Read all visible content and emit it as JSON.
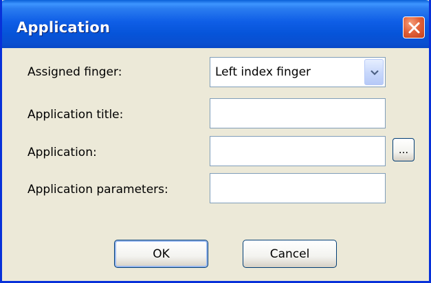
{
  "window": {
    "title": "Application",
    "close_label": "×"
  },
  "form": {
    "assigned_finger_label": "Assigned finger:",
    "assigned_finger_value": "Left index finger",
    "application_title_label": "Application title:",
    "application_title_value": "",
    "application_label": "Application:",
    "application_value": "",
    "browse_label": "...",
    "application_parameters_label": "Application parameters:",
    "application_parameters_value": ""
  },
  "buttons": {
    "ok_label": "OK",
    "cancel_label": "Cancel"
  },
  "colors": {
    "titlebar": "#0a5fd8",
    "window_border": "#0831d9",
    "close_button": "#e2623a",
    "dialog_background": "#ece9d8",
    "field_border": "#7f9db9"
  }
}
